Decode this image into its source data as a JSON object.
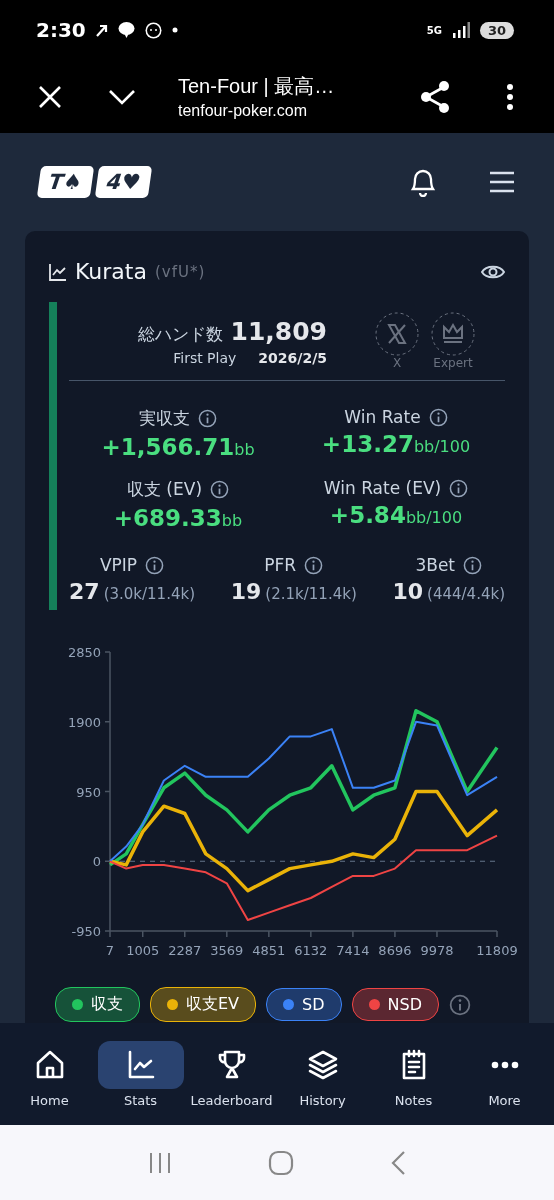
{
  "status_bar": {
    "time": "2:30",
    "network": "5G",
    "battery": "30"
  },
  "browser": {
    "title": "Ten-Four | 最高…",
    "url": "tenfour-poker.com"
  },
  "logo": [
    "T♠",
    "4♥"
  ],
  "player": {
    "name": "Kurata",
    "tag": "(vfU*)",
    "hands_label": "総ハンド数",
    "hands": "11,809",
    "first_play_label": "First Play",
    "first_play": "2026/2/5",
    "badges": [
      {
        "kind": "x",
        "label": "X"
      },
      {
        "kind": "crown",
        "label": "Expert"
      }
    ]
  },
  "stats": [
    {
      "label": "実収支",
      "value": "+1,566.71",
      "unit": "bb"
    },
    {
      "label": "Win Rate",
      "value": "+13.27",
      "unit": "bb/100"
    },
    {
      "label": "収支 (EV)",
      "value": "+689.33",
      "unit": "bb"
    },
    {
      "label": "Win Rate (EV)",
      "value": "+5.84",
      "unit": "bb/100"
    }
  ],
  "ratios": [
    {
      "label": "VPIP",
      "value": "27",
      "detail": "(3.0k/11.4k)"
    },
    {
      "label": "PFR",
      "value": "19",
      "detail": "(2.1k/11.4k)"
    },
    {
      "label": "3Bet",
      "value": "10",
      "detail": "(444/4.4k)"
    }
  ],
  "chart": {
    "chart_data": {
      "type": "line",
      "x": [
        7,
        500,
        1005,
        1650,
        2287,
        2930,
        3569,
        4210,
        4851,
        5490,
        6132,
        6770,
        7414,
        8050,
        8696,
        9340,
        9978,
        10900,
        11809
      ],
      "xlim": [
        7,
        11809
      ],
      "ylim": [
        -950,
        2850
      ],
      "xticks": [
        7,
        1005,
        2287,
        3569,
        4851,
        6132,
        7414,
        8696,
        9978,
        11809
      ],
      "yticks": [
        -950,
        0,
        950,
        1900,
        2850
      ],
      "series": [
        {
          "name": "収支",
          "color": "#22c55e",
          "values": [
            -50,
            100,
            500,
            1000,
            1200,
            900,
            700,
            400,
            700,
            900,
            1000,
            1300,
            700,
            900,
            1000,
            2050,
            1900,
            950,
            1550
          ]
        },
        {
          "name": "収支EV",
          "color": "#eab308",
          "values": [
            0,
            -50,
            400,
            750,
            650,
            100,
            -100,
            -400,
            -250,
            -100,
            -50,
            0,
            100,
            50,
            300,
            950,
            950,
            350,
            700
          ]
        },
        {
          "name": "SD",
          "color": "#3b82f6",
          "values": [
            0,
            200,
            500,
            1100,
            1300,
            1150,
            1150,
            1150,
            1400,
            1700,
            1700,
            1800,
            1000,
            1000,
            1100,
            1900,
            1850,
            900,
            1150
          ]
        },
        {
          "name": "NSD",
          "color": "#ef4444",
          "values": [
            0,
            -100,
            -50,
            -50,
            -100,
            -150,
            -300,
            -800,
            -700,
            -600,
            -500,
            -350,
            -200,
            -200,
            -100,
            150,
            150,
            150,
            350
          ]
        }
      ]
    }
  },
  "nav": [
    {
      "kind": "home",
      "label": "Home",
      "selected": false
    },
    {
      "kind": "stats",
      "label": "Stats",
      "selected": true
    },
    {
      "kind": "trophy",
      "label": "Leaderboard",
      "selected": false
    },
    {
      "kind": "layers",
      "label": "History",
      "selected": false
    },
    {
      "kind": "notes",
      "label": "Notes",
      "selected": false
    },
    {
      "kind": "more",
      "label": "More",
      "selected": false
    }
  ]
}
